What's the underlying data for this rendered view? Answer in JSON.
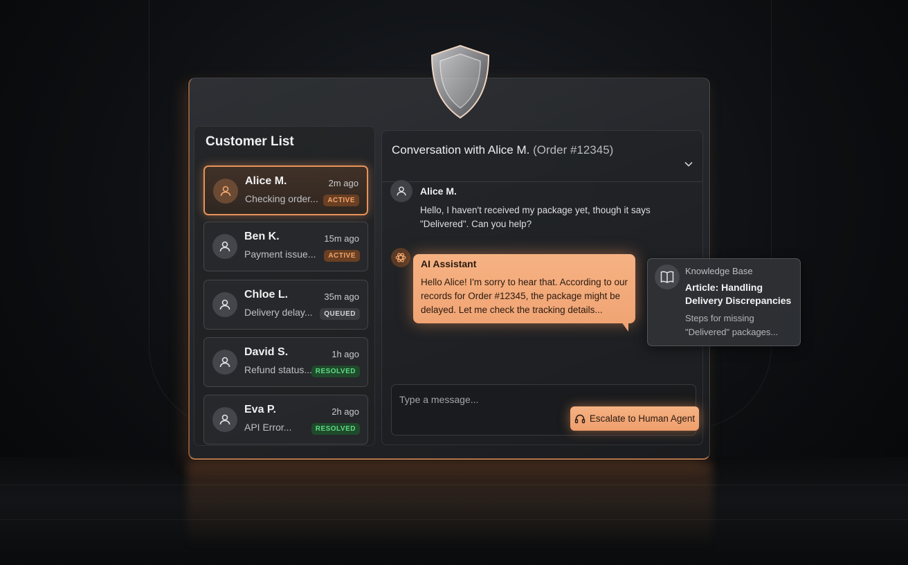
{
  "sidebar": {
    "title": "Customer List",
    "customers": [
      {
        "name": "Alice M.",
        "time": "2m ago",
        "preview": "Checking order...",
        "status": "ACTIVE"
      },
      {
        "name": "Ben K.",
        "time": "15m ago",
        "preview": "Payment issue...",
        "status": "ACTIVE"
      },
      {
        "name": "Chloe L.",
        "time": "35m ago",
        "preview": "Delivery delay...",
        "status": "QUEUED"
      },
      {
        "name": "David S.",
        "time": "1h ago",
        "preview": "Refund status...",
        "status": "RESOLVED"
      },
      {
        "name": "Eva P.",
        "time": "2h ago",
        "preview": "API Error...",
        "status": "RESOLVED"
      }
    ]
  },
  "conversation": {
    "title": "Conversation with Alice M.",
    "order": "(Order #12345)",
    "user_message": {
      "name": "Alice M.",
      "text": "Hello, I haven't received my package yet, though it says \"Delivered\". Can you help?"
    },
    "ai_message": {
      "name": "AI Assistant",
      "text": "Hello Alice! I'm sorry to hear that. According to our records for Order #12345, the package might be delayed. Let me check the tracking details..."
    }
  },
  "knowledge_base": {
    "label": "Knowledge Base",
    "title": "Article: Handling Delivery Discrepancies",
    "description": "Steps for missing \"Delivered\" packages..."
  },
  "composer": {
    "placeholder": "Type a message...",
    "escalate_label": "Escalate to Human Agent"
  },
  "colors": {
    "accent": "#f0a474",
    "active_badge": "#f2a66e",
    "resolved_badge": "#5edc86"
  }
}
